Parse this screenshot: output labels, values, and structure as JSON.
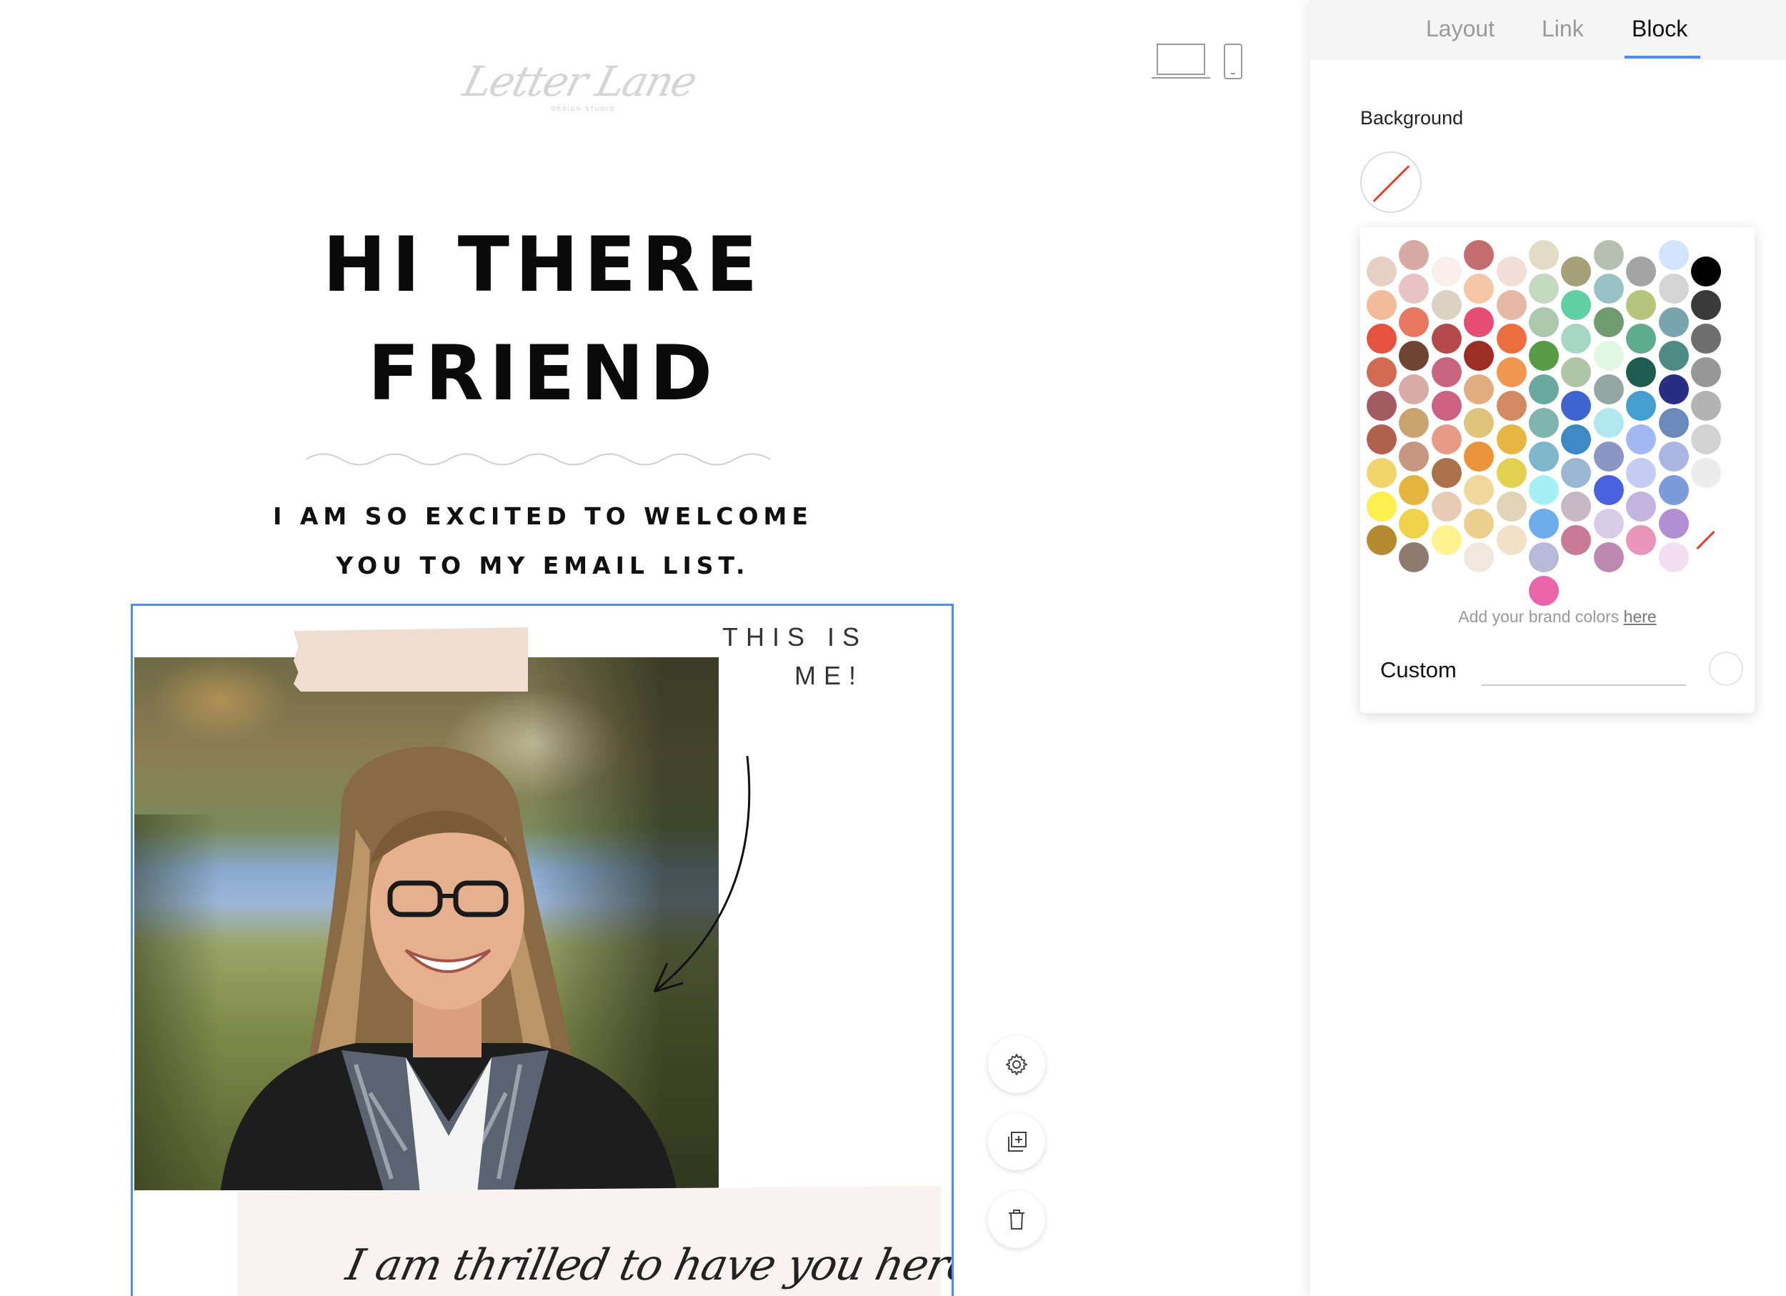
{
  "toolbar": {
    "device_desktop_icon": "laptop-icon",
    "device_mobile_icon": "phone-icon"
  },
  "email": {
    "logo": {
      "script": "Letter Lane",
      "subtitle": "DESIGN STUDIO"
    },
    "headline": [
      "HI THERE",
      "FRIEND"
    ],
    "subline": [
      "I AM SO EXCITED TO WELCOME",
      "YOU TO MY EMAIL LIST."
    ],
    "block": {
      "caption": [
        "THIS IS",
        "ME!"
      ],
      "note": "I am thrilled to have you here! You"
    }
  },
  "block_actions": [
    {
      "name": "settings",
      "icon": "gear-icon"
    },
    {
      "name": "duplicate",
      "icon": "duplicate-icon"
    },
    {
      "name": "delete",
      "icon": "trash-icon"
    }
  ],
  "panel": {
    "tabs": [
      {
        "label": "Layout",
        "active": false
      },
      {
        "label": "Link",
        "active": false
      },
      {
        "label": "Block",
        "active": true
      }
    ],
    "background_label": "Background",
    "picker": {
      "brand_hint_prefix": "Add your brand colors ",
      "brand_hint_link": "here",
      "custom_label": "Custom",
      "custom_value": "",
      "accent_color": "#4c8ef0",
      "columns": [
        [
          "#e8cfc4",
          "#f3bc99",
          "#e5533f",
          "#cf6b52",
          "#a25a63",
          "#b0614f",
          "#f1d46b",
          "#fcef4e",
          "#b48b2e"
        ],
        [
          "#d6aaa3",
          "#e7c4c4",
          "#e7785f",
          "#6e4433",
          "#d6aba8",
          "#c8a46f",
          "#c79680",
          "#e6b43a",
          "#f0d34a",
          "#8d7b70"
        ],
        [
          "#f8efed",
          "#dbd2c4",
          "#b44b4a",
          "#c7657e",
          "#cc6283",
          "#e89a86",
          "#a97248",
          "#e7cbb5",
          "#fef38c"
        ],
        [
          "#c46d6e",
          "#f6c7a7",
          "#e54e72",
          "#9b2d22",
          "#e3ad82",
          "#e1c47c",
          "#eb9338",
          "#f2d79a",
          "#eccf8c",
          "#f0e8dd"
        ],
        [
          "#f3ddd7",
          "#e5b7a5",
          "#ea6f3c",
          "#f0964f",
          "#d48a60",
          "#e7b640",
          "#e3d04f",
          "#dfd4b6",
          "#f2e1c8"
        ],
        [
          "#e2dbc5",
          "#c5d8c2",
          "#a9c8ad",
          "#589b45",
          "#68a9a0",
          "#80b5ae",
          "#7eb7cc",
          "#a5f0f2",
          "#6dabeb",
          "#b7b9d8",
          "#e964a9"
        ],
        [
          "#a4a078",
          "#60d0a2",
          "#a6d7c4",
          "#aec5a5",
          "#3e65cd",
          "#3f88c7",
          "#99b6d2",
          "#c7b7c4",
          "#c97a96"
        ],
        [
          "#b6beb0",
          "#99c2c4",
          "#6f9d71",
          "#e3f7e3",
          "#93a6a3",
          "#b1e8ee",
          "#8b96c6",
          "#4a61e0",
          "#d8ccea",
          "#bd8aaf"
        ],
        [
          "#a4a4a4",
          "#b5c57c",
          "#5fab8d",
          "#1f5c4d",
          "#459ed2",
          "#a4b7f5",
          "#c4ccf4",
          "#c4b4e0",
          "#e996bb"
        ],
        [
          "#d1e3fd",
          "#d3d4d3",
          "#7aa4b0",
          "#4f8b84",
          "#282e84",
          "#6a8aba",
          "#abb4e3",
          "#7c9bdb",
          "#b18ed2",
          "#f3dff2"
        ],
        [
          "#000000",
          "#3a3a3a",
          "#6e6e6e",
          "#979797",
          "#b3b3b3",
          "#d3d3d3",
          "#ececec",
          "#ffffff",
          "none"
        ]
      ]
    }
  }
}
